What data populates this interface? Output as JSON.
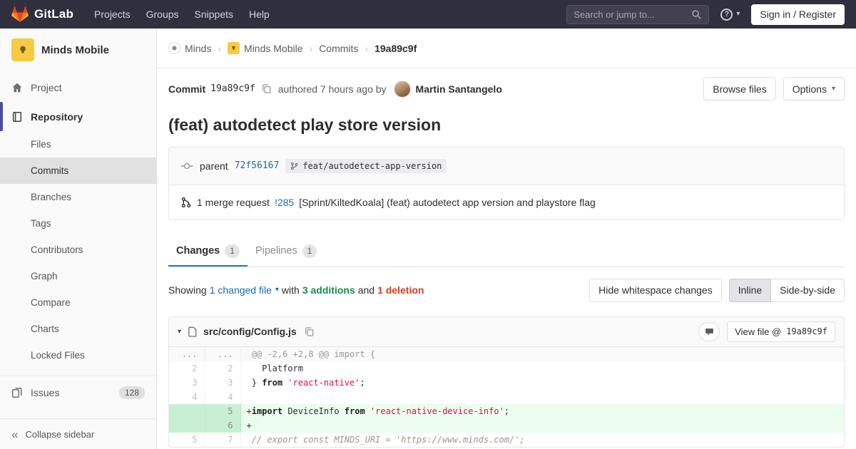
{
  "colors": {
    "navbar_bg": "#2f2f3d",
    "brand_orange": "#fc6d26",
    "link_blue": "#1b69b6",
    "tab_active_blue": "#1f78d1",
    "additions_green": "#168f48",
    "deletions_red": "#db3b21",
    "added_line_bg": "#ecfdf0",
    "added_line_number_bg": "#c7f0d2",
    "sidebar_active_indicator": "#4b4ba3",
    "project_avatar_yellow": "#f8ca43"
  },
  "glyphs": {
    "caret_down": "▾",
    "collapse": "«",
    "help": "?"
  },
  "navbar": {
    "brand": "GitLab",
    "links": [
      "Projects",
      "Groups",
      "Snippets",
      "Help"
    ],
    "search_placeholder": "Search or jump to...",
    "sign_in_label": "Sign in / Register"
  },
  "sidebar": {
    "project_name": "Minds Mobile",
    "items": {
      "project": "Project",
      "repository": "Repository",
      "issues": "Issues"
    },
    "repo_items": [
      "Files",
      "Commits",
      "Branches",
      "Tags",
      "Contributors",
      "Graph",
      "Compare",
      "Charts",
      "Locked Files"
    ],
    "issues_count": "128",
    "collapse_label": "Collapse sidebar"
  },
  "breadcrumb": {
    "separator": "›",
    "items": [
      "Minds",
      "Minds Mobile",
      "Commits"
    ],
    "current": "19a89c9f"
  },
  "commit": {
    "label": "Commit",
    "sha": "19a89c9f",
    "authored": "authored 7 hours ago by",
    "author": "Martin Santangelo",
    "browse_files_label": "Browse files",
    "options_label": "Options",
    "title": "(feat) autodetect play store version",
    "parent_label": "parent",
    "parent_sha": "72f56167",
    "branch": "feat/autodetect-app-version",
    "mr_count_label": "1 merge request",
    "mr_ref": "!285",
    "mr_title": "[Sprint/KiltedKoala] (feat) autodetect app version and playstore flag"
  },
  "tabs": {
    "changes_label": "Changes",
    "changes_count": "1",
    "pipelines_label": "Pipelines",
    "pipelines_count": "1"
  },
  "diff_meta": {
    "showing": "Showing",
    "changed_files": "1 changed file",
    "with": "with",
    "additions": "3 additions",
    "and": "and",
    "deletions": "1 deletion",
    "hide_whitespace_label": "Hide whitespace changes",
    "inline_label": "Inline",
    "side_by_side_label": "Side-by-side"
  },
  "file": {
    "path": "src/config/Config.js",
    "view_file_label": "View file @",
    "view_file_sha": "19a89c9f"
  },
  "diff": {
    "lines": [
      {
        "type": "match",
        "old": "...",
        "new": "...",
        "segments": [
          {
            "text": "@@ -2,6 +2,8 @@ import {"
          }
        ]
      },
      {
        "type": "context",
        "old": "2",
        "new": "2",
        "segments": [
          {
            "text": "  Platform"
          }
        ]
      },
      {
        "type": "context",
        "old": "3",
        "new": "3",
        "segments": [
          {
            "text": "} "
          },
          {
            "cls": "k",
            "text": "from"
          },
          {
            "text": " "
          },
          {
            "cls": "s",
            "text": "'react-native'"
          },
          {
            "text": ";"
          }
        ]
      },
      {
        "type": "context",
        "old": "4",
        "new": "4",
        "segments": []
      },
      {
        "type": "add",
        "old": "",
        "new": "5",
        "segments": [
          {
            "cls": "k",
            "text": "import"
          },
          {
            "text": " DeviceInfo "
          },
          {
            "cls": "k",
            "text": "from"
          },
          {
            "text": " "
          },
          {
            "cls": "s",
            "text": "'react-native-device-info'"
          },
          {
            "text": ";"
          }
        ]
      },
      {
        "type": "add",
        "old": "",
        "new": "6",
        "segments": []
      },
      {
        "type": "context",
        "old": "5",
        "new": "7",
        "segments": [
          {
            "cls": "c",
            "text": "// export const MINDS_URI = 'https://www.minds.com/';"
          }
        ]
      }
    ]
  }
}
